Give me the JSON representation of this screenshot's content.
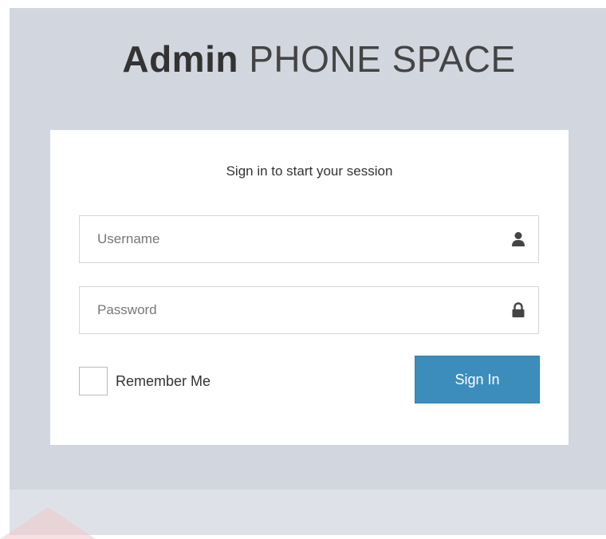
{
  "logo": {
    "bold": "Admin",
    "light": "PHONE SPACE"
  },
  "login": {
    "message": "Sign in to start your session",
    "username_placeholder": "Username",
    "password_placeholder": "Password",
    "remember_label": "Remember Me",
    "signin_label": "Sign In"
  },
  "icons": {
    "username": "user-icon",
    "password": "lock-icon"
  },
  "colors": {
    "background": "#d2d6de",
    "button": "#3c8dbc"
  }
}
